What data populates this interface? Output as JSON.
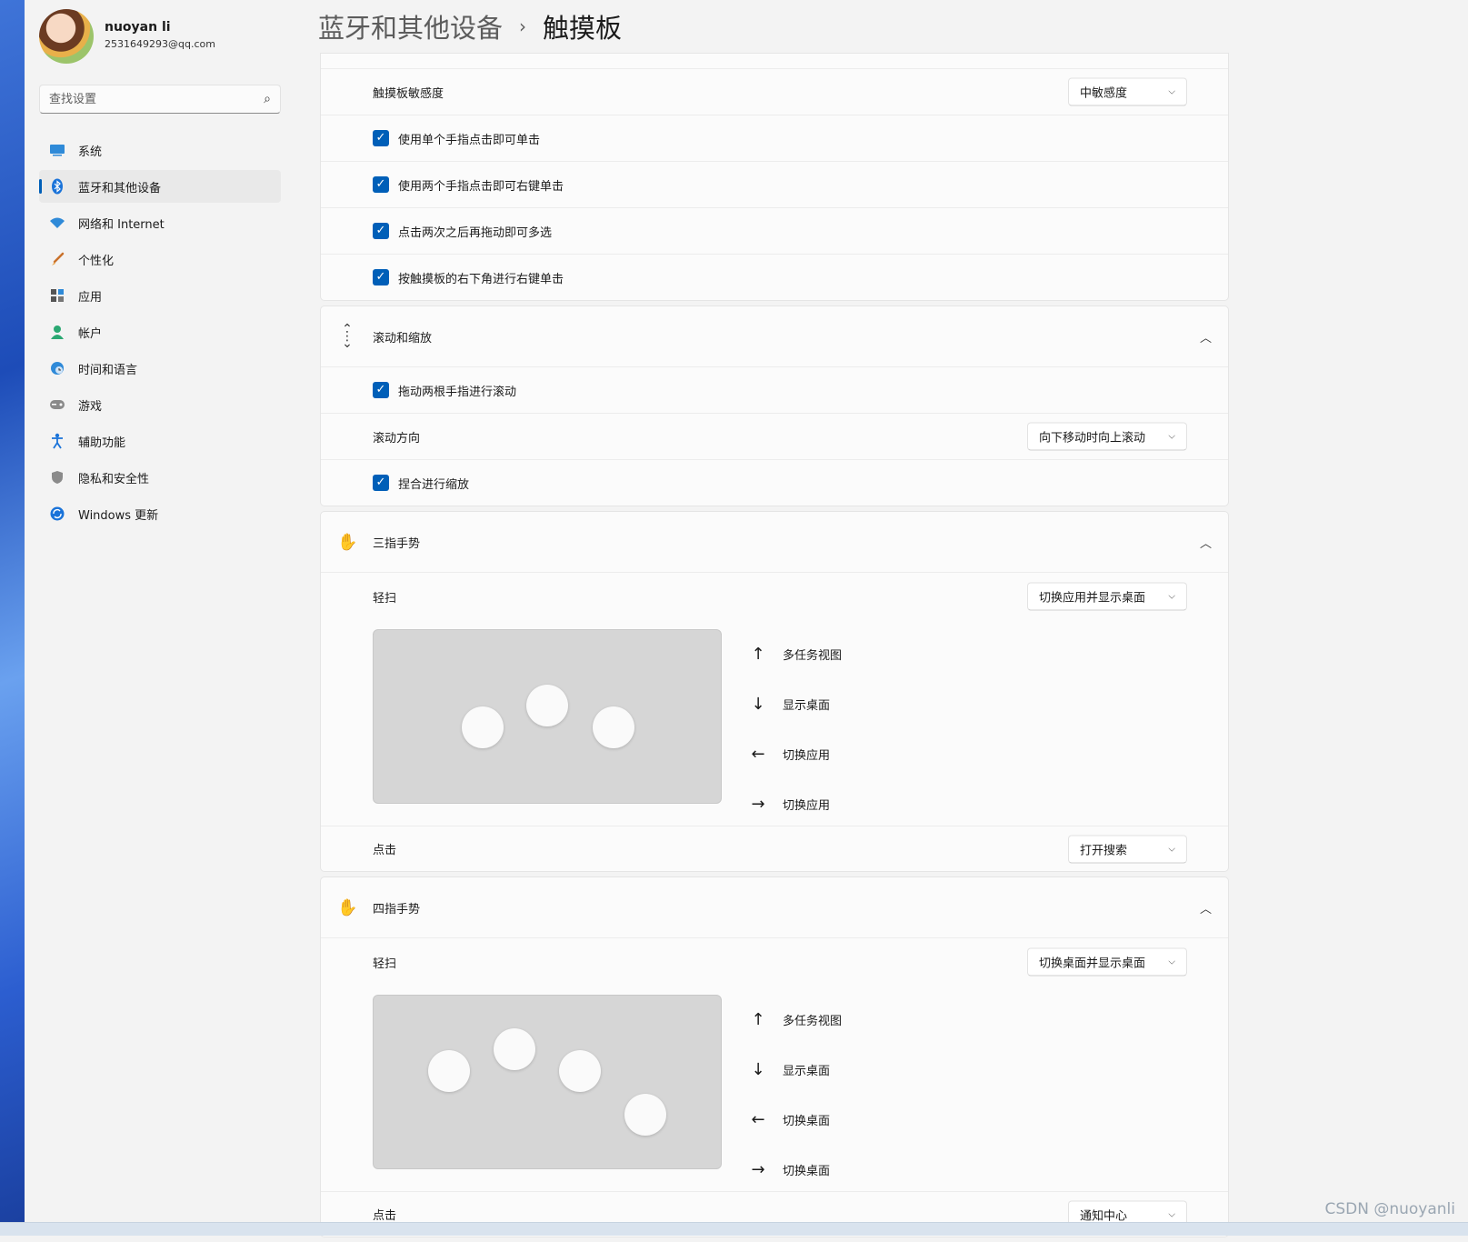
{
  "user": {
    "name": "nuoyan li",
    "email": "2531649293@qq.com"
  },
  "search": {
    "placeholder": "查找设置"
  },
  "nav": [
    {
      "label": "系统",
      "icon": "display-icon",
      "active": false
    },
    {
      "label": "蓝牙和其他设备",
      "icon": "bluetooth-icon",
      "active": true
    },
    {
      "label": "网络和 Internet",
      "icon": "wifi-icon",
      "active": false
    },
    {
      "label": "个性化",
      "icon": "brush-icon",
      "active": false
    },
    {
      "label": "应用",
      "icon": "apps-icon",
      "active": false
    },
    {
      "label": "帐户",
      "icon": "person-icon",
      "active": false
    },
    {
      "label": "时间和语言",
      "icon": "globe-clock-icon",
      "active": false
    },
    {
      "label": "游戏",
      "icon": "gamepad-icon",
      "active": false
    },
    {
      "label": "辅助功能",
      "icon": "accessibility-icon",
      "active": false
    },
    {
      "label": "隐私和安全性",
      "icon": "shield-icon",
      "active": false
    },
    {
      "label": "Windows 更新",
      "icon": "update-icon",
      "active": false
    }
  ],
  "breadcrumb": {
    "parent": "蓝牙和其他设备",
    "separator": "›",
    "current": "触摸板"
  },
  "taps": {
    "sensitivity_label": "触摸板敏感度",
    "sensitivity_value": "中敏感度",
    "options": [
      {
        "label": "使用单个手指点击即可单击",
        "checked": true
      },
      {
        "label": "使用两个手指点击即可右键单击",
        "checked": true
      },
      {
        "label": "点击两次之后再拖动即可多选",
        "checked": true
      },
      {
        "label": "按触摸板的右下角进行右键单击",
        "checked": true
      }
    ]
  },
  "scroll": {
    "title": "滚动和缩放",
    "drag_label": "拖动两根手指进行滚动",
    "direction_label": "滚动方向",
    "direction_value": "向下移动时向上滚动",
    "pinch_label": "捏合进行缩放"
  },
  "three_finger": {
    "title": "三指手势",
    "swipe_label": "轻扫",
    "swipe_value": "切换应用并显示桌面",
    "actions": [
      {
        "arrow": "↑",
        "text": "多任务视图"
      },
      {
        "arrow": "↓",
        "text": "显示桌面"
      },
      {
        "arrow": "←",
        "text": "切换应用"
      },
      {
        "arrow": "→",
        "text": "切换应用"
      }
    ],
    "tap_label": "点击",
    "tap_value": "打开搜索"
  },
  "four_finger": {
    "title": "四指手势",
    "swipe_label": "轻扫",
    "swipe_value": "切换桌面并显示桌面",
    "actions": [
      {
        "arrow": "↑",
        "text": "多任务视图"
      },
      {
        "arrow": "↓",
        "text": "显示桌面"
      },
      {
        "arrow": "←",
        "text": "切换桌面"
      },
      {
        "arrow": "→",
        "text": "切换桌面"
      }
    ],
    "tap_label": "点击",
    "tap_value": "通知中心"
  },
  "watermark": "CSDN @nuoyanli",
  "colors": {
    "accent": "#005fb8",
    "background": "#f3f3f3",
    "card": "#fbfbfb"
  }
}
